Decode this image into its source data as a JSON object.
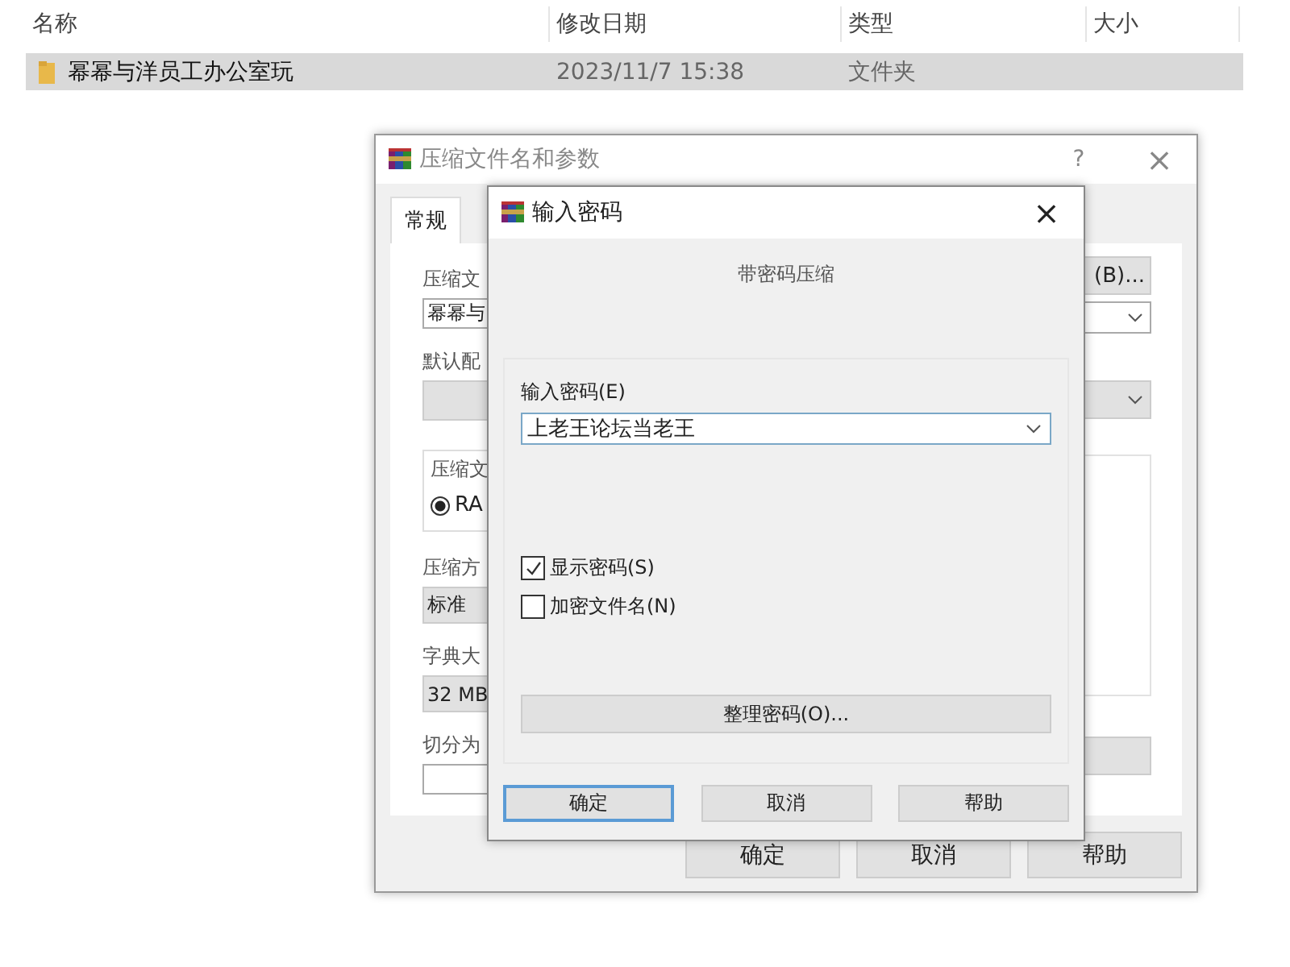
{
  "file_list": {
    "columns": [
      "名称",
      "修改日期",
      "类型",
      "大小"
    ],
    "rows": [
      {
        "name": "幂幂与洋员工办公室玩",
        "modified": "2023/11/7 15:38",
        "type": "文件夹",
        "selected": true
      }
    ]
  },
  "archive_dialog": {
    "title": "压缩文件名和参数",
    "help": "?",
    "close": "×",
    "tabs": [
      {
        "label": "常规",
        "selected": true
      }
    ],
    "left_items": [
      {
        "kind": "label",
        "text": "压缩文"
      },
      {
        "kind": "input",
        "value": "幂幂与"
      },
      {
        "kind": "label",
        "text": "默认配"
      },
      {
        "kind": "combo",
        "value": ""
      },
      {
        "kind": "group",
        "text": "压缩文",
        "radio": {
          "label": "RA",
          "selected": true
        }
      },
      {
        "kind": "label",
        "text": "压缩方"
      },
      {
        "kind": "combo",
        "value": "标准"
      },
      {
        "kind": "label",
        "text": "字典大"
      },
      {
        "kind": "combo",
        "value": "32 MB"
      },
      {
        "kind": "label",
        "text": "切分为"
      },
      {
        "kind": "input",
        "value": ""
      }
    ],
    "right_items": [
      {
        "kind": "button",
        "text": "(B)..."
      },
      {
        "kind": "dropdown"
      },
      {
        "kind": "combo"
      },
      {
        "kind": "list"
      },
      {
        "kind": "button"
      }
    ],
    "buttons": [
      "确定",
      "取消",
      "帮助"
    ]
  },
  "password_dialog": {
    "title": "输入密码",
    "close": "×",
    "heading": "带密码压缩",
    "password_label": "输入密码(E)",
    "password_value": "上老王论坛当老王",
    "options": [
      {
        "label": "显示密码(S)",
        "checked": true
      },
      {
        "label": "加密文件名(N)",
        "checked": false
      }
    ],
    "manage_button": "整理密码(O)...",
    "buttons": [
      {
        "label": "确定",
        "default": true
      },
      {
        "label": "取消",
        "default": false
      },
      {
        "label": "帮助",
        "default": false
      }
    ]
  }
}
